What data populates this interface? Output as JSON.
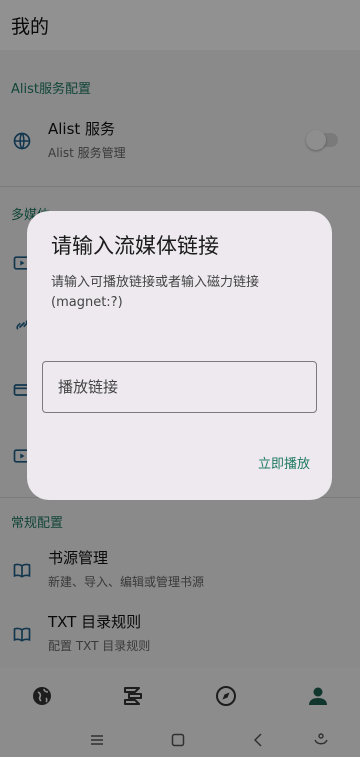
{
  "header": {
    "title": "我的"
  },
  "sections": {
    "alist_title": "Alist服务配置",
    "media_title_partial": "多媒体",
    "general_title": "常规配置"
  },
  "alist_row": {
    "title": "Alist 服务",
    "subtitle": "Alist 服务管理",
    "toggle_on": false
  },
  "general_rows": [
    {
      "title": "书源管理",
      "subtitle": "新建、导入、编辑或管理书源"
    },
    {
      "title": "TXT 目录规则",
      "subtitle": "配置 TXT 目录规则"
    }
  ],
  "dialog": {
    "title": "请输入流媒体链接",
    "message": "请输入可播放链接或者输入磁力链接 (magnet:?)",
    "input_placeholder": "播放链接",
    "input_value": "",
    "confirm_label": "立即播放"
  },
  "bottom_nav": [
    "globe-icon",
    "bookshelf-icon",
    "compass-icon",
    "person-icon"
  ],
  "system_nav": [
    "menu-icon",
    "home-icon",
    "back-icon",
    "assist-icon"
  ],
  "colors": {
    "accent": "#1f7a63",
    "dialog_bg": "#ede9ef",
    "scrim": "rgba(0,0,0,0.43)"
  }
}
